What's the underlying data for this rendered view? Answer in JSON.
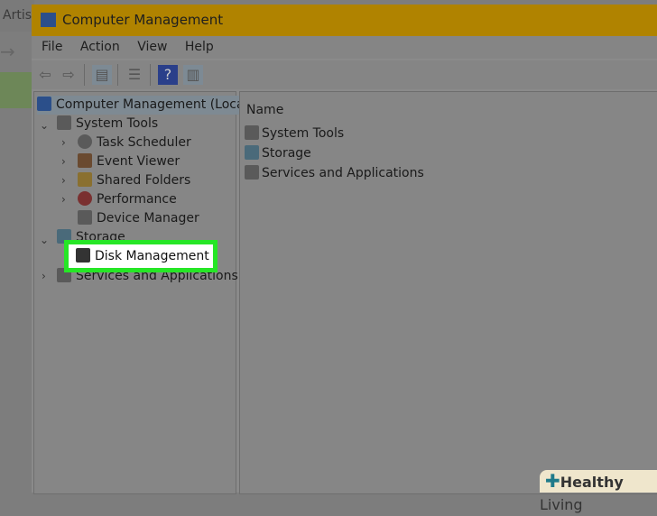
{
  "background": {
    "tab_text": "Artist"
  },
  "window": {
    "title": "Computer Management"
  },
  "menu": [
    "File",
    "Action",
    "View",
    "Help"
  ],
  "tree": {
    "root": "Computer Management (Local",
    "items": [
      {
        "label": "System Tools",
        "level": 1
      },
      {
        "label": "Task Scheduler",
        "level": 2
      },
      {
        "label": "Event Viewer",
        "level": 2
      },
      {
        "label": "Shared Folders",
        "level": 2
      },
      {
        "label": "Performance",
        "level": 2
      },
      {
        "label": "Device Manager",
        "level": 2
      },
      {
        "label": "Storage",
        "level": 1
      },
      {
        "label": "Disk Management",
        "level": 2
      },
      {
        "label": "Services and Applications",
        "level": 1
      }
    ]
  },
  "list": {
    "header": "Name",
    "items": [
      "System Tools",
      "Storage",
      "Services and Applications"
    ]
  },
  "highlight": {
    "label": "Disk Management",
    "color": "#26e626"
  },
  "watermark": {
    "brand_bold": "Healthy",
    "brand_light": "Living"
  }
}
